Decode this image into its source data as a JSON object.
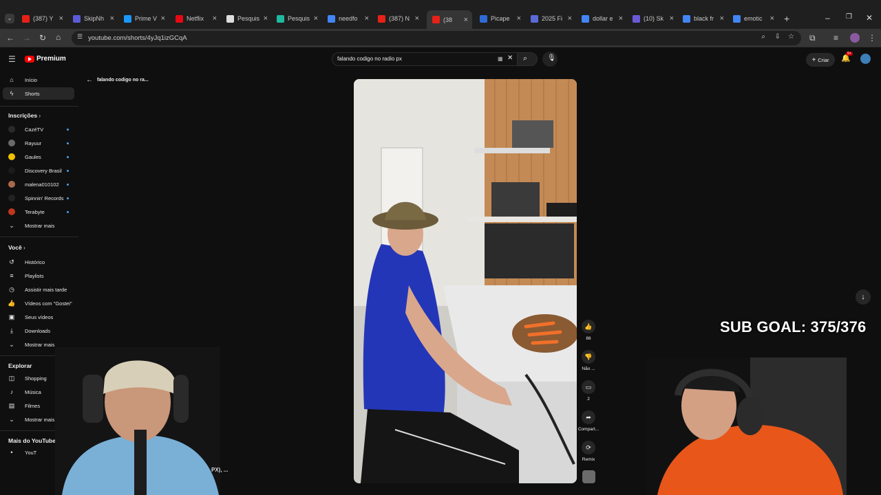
{
  "browser": {
    "tabs": [
      {
        "label": "(387) Y",
        "color": "#e62117"
      },
      {
        "label": "SkipNh",
        "color": "#5b5bd6"
      },
      {
        "label": "Prime V",
        "color": "#1a98ff"
      },
      {
        "label": "Netflix",
        "color": "#e50914"
      },
      {
        "label": "Pesquis",
        "color": "#dddddd"
      },
      {
        "label": "Pesquis",
        "color": "#20b8a0"
      },
      {
        "label": "needfo",
        "color": "#4285f4"
      },
      {
        "label": "(387) N",
        "color": "#e62117"
      },
      {
        "label": "(38",
        "color": "#e62117"
      },
      {
        "label": "Picape",
        "color": "#2e6bd6"
      },
      {
        "label": "2025 Fi",
        "color": "#5a6ad6"
      },
      {
        "label": "dollar e",
        "color": "#4285f4"
      },
      {
        "label": "(10) Sk",
        "color": "#6a5ad6"
      },
      {
        "label": "black fr",
        "color": "#4285f4"
      },
      {
        "label": "emotic",
        "color": "#4285f4"
      }
    ],
    "url": "youtube.com/shorts/4yJq1izGCqA"
  },
  "header": {
    "logo_label": "Premium",
    "search_value": "falando codigo no radio px",
    "create_label": "Criar",
    "notif_count": "9+"
  },
  "back_link": "falando codigo no ra...",
  "sidebar": {
    "main": [
      {
        "label": "Início",
        "icon": "home-icon"
      },
      {
        "label": "Shorts",
        "icon": "shorts-icon"
      }
    ],
    "subs_title": "Inscrições",
    "subs": [
      {
        "label": "CazéTV",
        "color": "#2a2a2a"
      },
      {
        "label": "Rayuur",
        "color": "#6a6a6a"
      },
      {
        "label": "Gaules",
        "color": "#f2c200"
      },
      {
        "label": "Discovery Brasil",
        "color": "#1b1b1b"
      },
      {
        "label": "malena010102",
        "color": "#a86a4a"
      },
      {
        "label": "Spinnin' Records",
        "color": "#222222"
      },
      {
        "label": "Terabyte",
        "color": "#c2361c"
      }
    ],
    "subs_more": "Mostrar mais",
    "you_title": "Você",
    "you": [
      {
        "label": "Histórico",
        "icon": "history-icon"
      },
      {
        "label": "Playlists",
        "icon": "playlists-icon"
      },
      {
        "label": "Assistir mais tarde",
        "icon": "clock-icon"
      },
      {
        "label": "Vídeos com \"Gostei\"",
        "icon": "like-icon"
      },
      {
        "label": "Seus vídeos",
        "icon": "video-icon"
      },
      {
        "label": "Downloads",
        "icon": "download-icon"
      }
    ],
    "you_more": "Mostrar mais",
    "explore_title": "Explorar",
    "explore": [
      {
        "label": "Shopping",
        "icon": "bag-icon"
      },
      {
        "label": "Música",
        "icon": "music-icon"
      },
      {
        "label": "Filmes",
        "icon": "film-icon"
      }
    ],
    "explore_more": "Mostrar mais",
    "more_title": "Mais do YouTube",
    "more_item": "YouT"
  },
  "actions": {
    "like_count": "86",
    "dislike_label": "Não ...",
    "comments_count": "2",
    "share_label": "Compart...",
    "remix_label": "Remix"
  },
  "overlay": {
    "sub_goal": "SUB GOAL: 375/376",
    "caption_fragment": "PX), ..."
  }
}
